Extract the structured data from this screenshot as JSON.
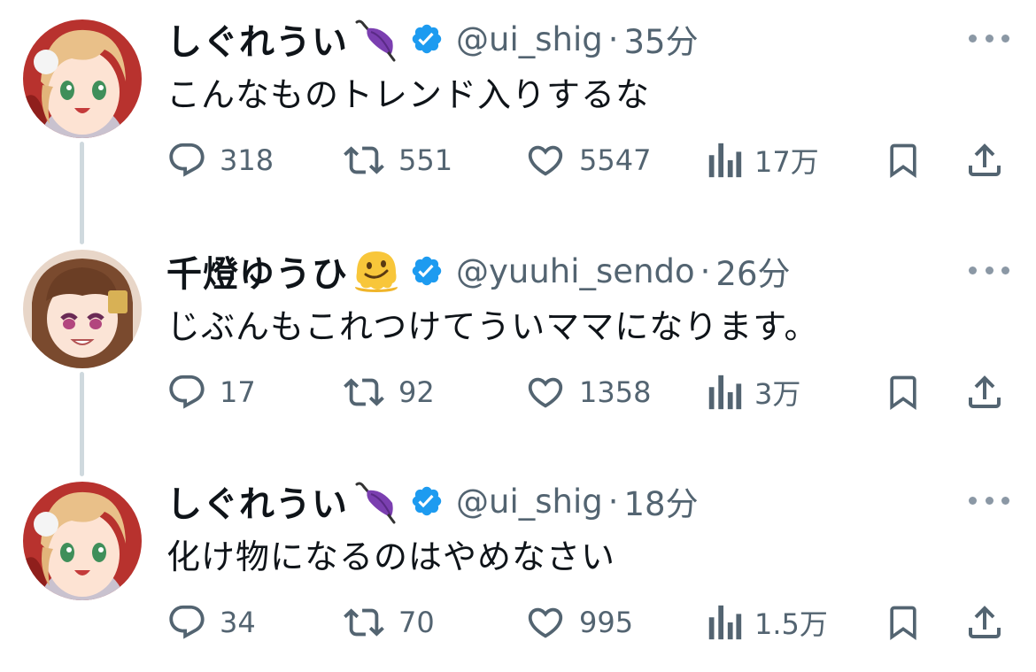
{
  "tweets": [
    {
      "display_name": "しぐれうい",
      "name_emoji": "umbrella-emoji",
      "handle": "@ui_shig",
      "dot": "·",
      "time": "35分",
      "text": "こんなものトレンド入りするな",
      "replies": "318",
      "retweets": "551",
      "likes": "5547",
      "views": "17万"
    },
    {
      "display_name": "千燈ゆうひ",
      "name_emoji": "melting-face-emoji",
      "handle": "@yuuhi_sendo",
      "dot": "·",
      "time": "26分",
      "text": "じぶんもこれつけてういママになります。",
      "replies": "17",
      "retweets": "92",
      "likes": "1358",
      "views": "3万"
    },
    {
      "display_name": "しぐれうい",
      "name_emoji": "umbrella-emoji",
      "handle": "@ui_shig",
      "dot": "·",
      "time": "18分",
      "text": "化け物になるのはやめなさい",
      "replies": "34",
      "retweets": "70",
      "likes": "995",
      "views": "1.5万"
    }
  ],
  "colors": {
    "text_primary": "#0f1419",
    "text_secondary": "#536471",
    "verified_blue": "#1d9bf0",
    "thread_line": "#cfd9de"
  }
}
